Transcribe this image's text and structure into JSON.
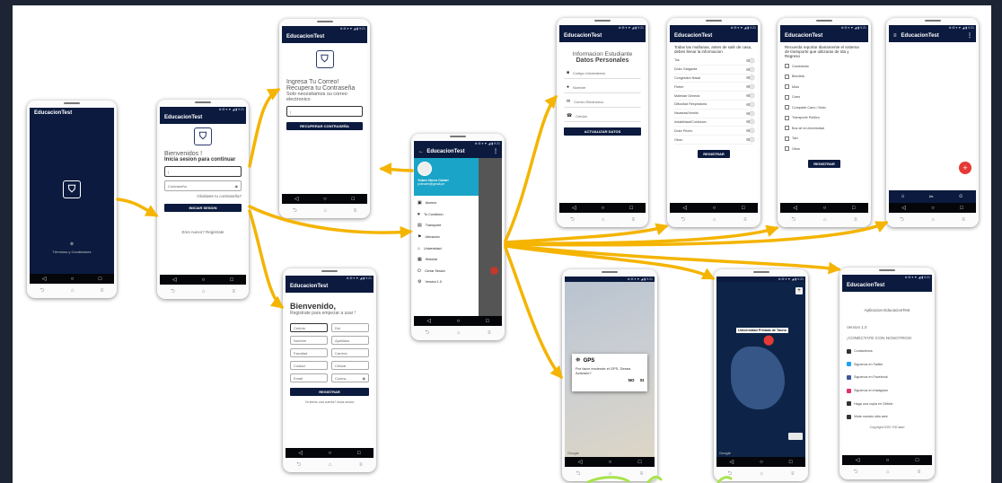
{
  "app_title": "EducacionTest",
  "status": "⊕ ⊞ ▾ ▼ ◢ ▮ 9:21",
  "nav": {
    "back": "◁",
    "home": "○",
    "recent": "□"
  },
  "hw": {
    "back": "⮌",
    "home": "⌂",
    "menu": "≡"
  },
  "splash": {
    "dot": "⊗",
    "terms": "Términos y Condiciones"
  },
  "login": {
    "welcome": "Bienvenidos !",
    "subtitle": "Inicia sesion para continuar",
    "email_label": "Email",
    "email_value": "|",
    "password_placeholder": "Contraseña",
    "forgot": "Olvidaste tu contraseña?",
    "button": "INICIAR SESION",
    "register": "Eres nuevo? Registrate"
  },
  "recover": {
    "line1": "Ingresa Tu Correo!",
    "line2": "Recupera tu Contraseña",
    "line3": "Solo necesitamos su correo electronico",
    "email_label": "Email",
    "email_value": "|",
    "button": "RECUPERAR CONTRASEÑA"
  },
  "signup": {
    "title": "Bienvenido,",
    "subtitle": "Registrate para empezar a usar !",
    "fields": [
      [
        "Cedula",
        "Dni"
      ],
      [
        "Nombre",
        "Apellidos"
      ],
      [
        "Facultad",
        "Carrera"
      ],
      [
        "Ciudad",
        "Celular"
      ],
      [
        "Email",
        "Contra..."
      ]
    ],
    "button": "REGISTRAR",
    "footer": "Ya tienes una cuenta? Inicia sesion"
  },
  "drawer": {
    "user_name": "Yober Noen Catari",
    "user_email": "yobnoen@gmail.pe",
    "items": [
      "Alumno",
      "Tu Condicion",
      "Transporte",
      "Ubicacion",
      "Universidad",
      "Historial",
      "Cerrar Sesion",
      "Version 1.0"
    ]
  },
  "student": {
    "title": "Informacion Estudiante",
    "subtitle": "Datos Personales",
    "placeholders": [
      "Codigo Universitario",
      "Nombre",
      "Correo Electronico",
      "Celular"
    ],
    "button": "ACTUALIZAR DATOS"
  },
  "symptoms": {
    "intro": "Todas las mañanas, antes de salir de casa, debes llenar la informacion",
    "items": [
      "Tos",
      "Dolor Garganta",
      "Congestion Nasal",
      "Fiebre",
      "Malestar General",
      "Dificultad Respiratoria",
      "Nauseas/Vomito",
      "Irritabilidad/Confusion",
      "Dolor Pecho",
      "Otros"
    ],
    "button": "REGISTRAR"
  },
  "transport": {
    "intro": "Recuerda reportar diariamente el sistema de transporte que utilizaras de Ida y Regreso",
    "items": [
      "Caminando",
      "Bicicleta",
      "Moto",
      "Carro",
      "Compartir Carro / Moto",
      "Transporte Publico",
      "Bus de la Universidad",
      "Taxi",
      "Otros"
    ],
    "button": "REGISTRAR"
  },
  "home_app": {
    "menu_icon": "≡",
    "fab": "+",
    "tab1": "⌂",
    "tab2": "✂",
    "tab3": "☺"
  },
  "gps": {
    "dialog_title": "GPS",
    "dialog_text": "Por favor enciende el GPS. Desea Activarlo?",
    "no": "NO",
    "yes": "SI",
    "google": "Google"
  },
  "map": {
    "label": "Universidad Privada de Tacna",
    "google": "Google"
  },
  "about": {
    "title": "Aplicacion EducacionTest",
    "version": "Version 1.0",
    "connect": "¡CONÉCTATE CON NOSOTROS!",
    "links": [
      "Contactenos",
      "Siguenos en Twitter",
      "Siguenos en Facebook",
      "Siguenos en Instagram",
      "Haga una copia en GitHub",
      "Visite nuestro sitio web"
    ],
    "copyright": "Copyright 2020 YNCatari"
  }
}
